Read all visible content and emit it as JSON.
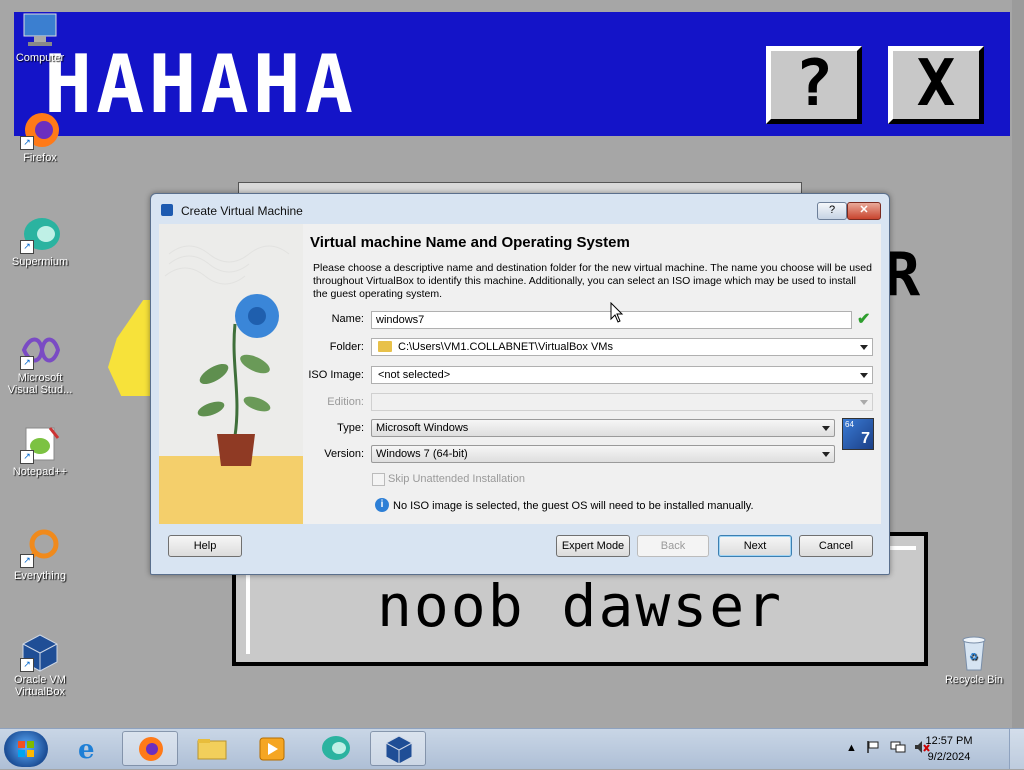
{
  "prank": {
    "banner_title": "HAHAHA",
    "help_glyph": "?",
    "close_glyph": "X",
    "message": "noob dawser",
    "partial_glyph": "R"
  },
  "desktop_icons": [
    {
      "label": "Computer",
      "icon": "computer-icon"
    },
    {
      "label": "Firefox",
      "icon": "firefox-icon"
    },
    {
      "label": "Supermium",
      "icon": "supermium-icon"
    },
    {
      "label": "Microsoft Visual Stud...",
      "icon": "visual-studio-icon"
    },
    {
      "label": "Notepad++",
      "icon": "notepad-plus-plus-icon"
    },
    {
      "label": "Everything",
      "icon": "everything-search-icon"
    },
    {
      "label": "Oracle VM VirtualBox",
      "icon": "virtualbox-icon"
    },
    {
      "label": "Recycle Bin",
      "icon": "recycle-bin-icon"
    }
  ],
  "dialog": {
    "title": "Create Virtual Machine",
    "help_glyph": "?",
    "close_glyph": "✕",
    "heading": "Virtual machine Name and Operating System",
    "description": "Please choose a descriptive name and destination folder for the new virtual machine. The name you choose will be used throughout VirtualBox to identify this machine. Additionally, you can select an ISO image which may be used to install the guest operating system.",
    "fields": {
      "name_label": "Name:",
      "name_value": "windows7",
      "folder_label": "Folder:",
      "folder_value": "C:\\Users\\VM1.COLLABNET\\VirtualBox VMs",
      "iso_label": "ISO Image:",
      "iso_value": "<not selected>",
      "edition_label": "Edition:",
      "edition_value": "",
      "type_label": "Type:",
      "type_value": "Microsoft Windows",
      "version_label": "Version:",
      "version_value": "Windows 7 (64-bit)"
    },
    "os_badge": {
      "bits": "64",
      "number": "7"
    },
    "skip_unattended_label": "Skip Unattended Installation",
    "skip_unattended_checked": false,
    "info_text": "No ISO image is selected, the guest OS will need to be installed manually.",
    "buttons": {
      "help": "Help",
      "expert": "Expert Mode",
      "back": "Back",
      "next": "Next",
      "cancel": "Cancel"
    }
  },
  "taskbar": {
    "apps": [
      {
        "icon": "internet-explorer-icon",
        "active": false
      },
      {
        "icon": "firefox-icon",
        "active": true
      },
      {
        "icon": "file-explorer-icon",
        "active": false
      },
      {
        "icon": "media-player-icon",
        "active": false
      },
      {
        "icon": "supermium-icon",
        "active": false
      },
      {
        "icon": "virtualbox-icon",
        "active": true
      }
    ],
    "clock_time": "12:57 PM",
    "clock_date": "9/2/2024",
    "tray_icons": [
      "show-hidden-icons-icon",
      "action-center-flag-icon",
      "network-icon",
      "volume-muted-icon"
    ]
  },
  "colors": {
    "banner_blue": "#1414c8",
    "desktop_gray": "#a6a6a6",
    "dialog_frame": "#d8e4f2",
    "accept_green": "#2e9e2e"
  }
}
